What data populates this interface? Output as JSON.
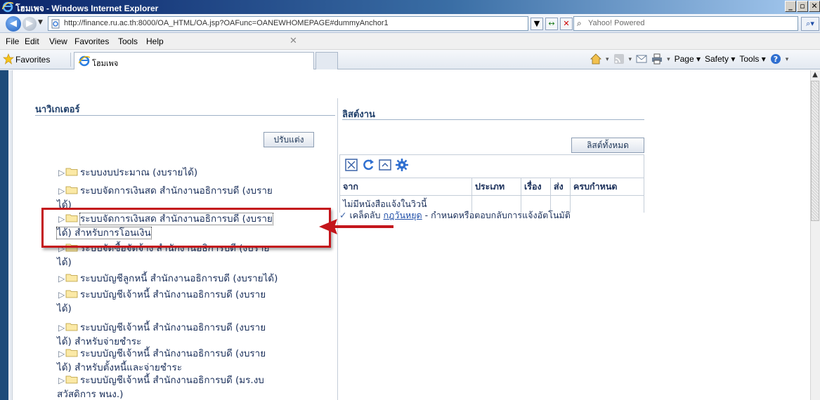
{
  "window": {
    "title": "โฮมเพจ - Windows Internet Explorer",
    "buttons": [
      "_",
      "▫",
      "✕"
    ]
  },
  "addressbar": {
    "url": "http://finance.ru.ac.th:8000/OA_HTML/OA.jsp?OAFunc=OANEWHOMEPAGE#dummyAnchor1",
    "search_placeholder": "Yahoo! Powered"
  },
  "menubar": {
    "items": [
      "File",
      "Edit",
      "View",
      "Favorites",
      "Tools",
      "Help"
    ]
  },
  "favbar": {
    "favorites_label": "Favorites",
    "tab_title": "โฮมเพจ",
    "commands": [
      "Page ▾",
      "Safety ▾",
      "Tools ▾"
    ]
  },
  "navigator": {
    "title": "นาวิเกเตอร์",
    "customize_label": "ปรับแต่ง",
    "items": [
      {
        "line1": "ระบบงบประมาณ (งบรายได้)",
        "line2": ""
      },
      {
        "line1": "ระบบจัดการเงินสด สำนักงานอธิการบดี (งบราย",
        "line2": "ได้)"
      },
      {
        "line1": "ระบบจัดการเงินสด สำนักงานอธิการบดี (งบราย",
        "line2": "ได้) สำหรับการโอนเงิน"
      },
      {
        "line1": "ระบบจัดซื้อจัดจ้าง สำนักงานอธิการบดี (งบราย",
        "line2": "ได้)"
      },
      {
        "line1": "ระบบบัญชีลูกหนี้ สำนักงานอธิการบดี (งบรายได้)",
        "line2": ""
      },
      {
        "line1": "ระบบบัญชีเจ้าหนี้ สำนักงานอธิการบดี (งบราย",
        "line2": "ได้)"
      },
      {
        "line1": "ระบบบัญชีเจ้าหนี้ สำนักงานอธิการบดี (งบราย",
        "line2": "ได้) สำหรับจ่ายชำระ"
      },
      {
        "line1": "ระบบบัญชีเจ้าหนี้ สำนักงานอธิการบดี (งบราย",
        "line2": "ได้) สำหรับตั้งหนี้และจ่ายชำระ"
      },
      {
        "line1": "ระบบบัญชีเจ้าหนี้ สำนักงานอธิการบดี (มร.งบ",
        "line2": "สวัสดิการ พนง.)"
      }
    ]
  },
  "worklist": {
    "title": "ลิสต์งาน",
    "full_list_label": "ลิสต์ทั้งหมด",
    "columns": [
      "จาก",
      "ประเภท",
      "เรื่อง",
      "ส่ง",
      "ครบกำหนด"
    ],
    "empty_message": "ไม่มีหนังสือแจ้งในวิวนี้",
    "tip_prefix": "เคล็ดลับ",
    "tip_link": "กฎวันหยุด",
    "tip_text": " - กำหนดหรือตอบกลับการแจ้งอัตโนมัติ"
  },
  "colors": {
    "highlight": "#c4161c",
    "nav_title": "#1f3f6a",
    "link": "#1f4ea8"
  }
}
